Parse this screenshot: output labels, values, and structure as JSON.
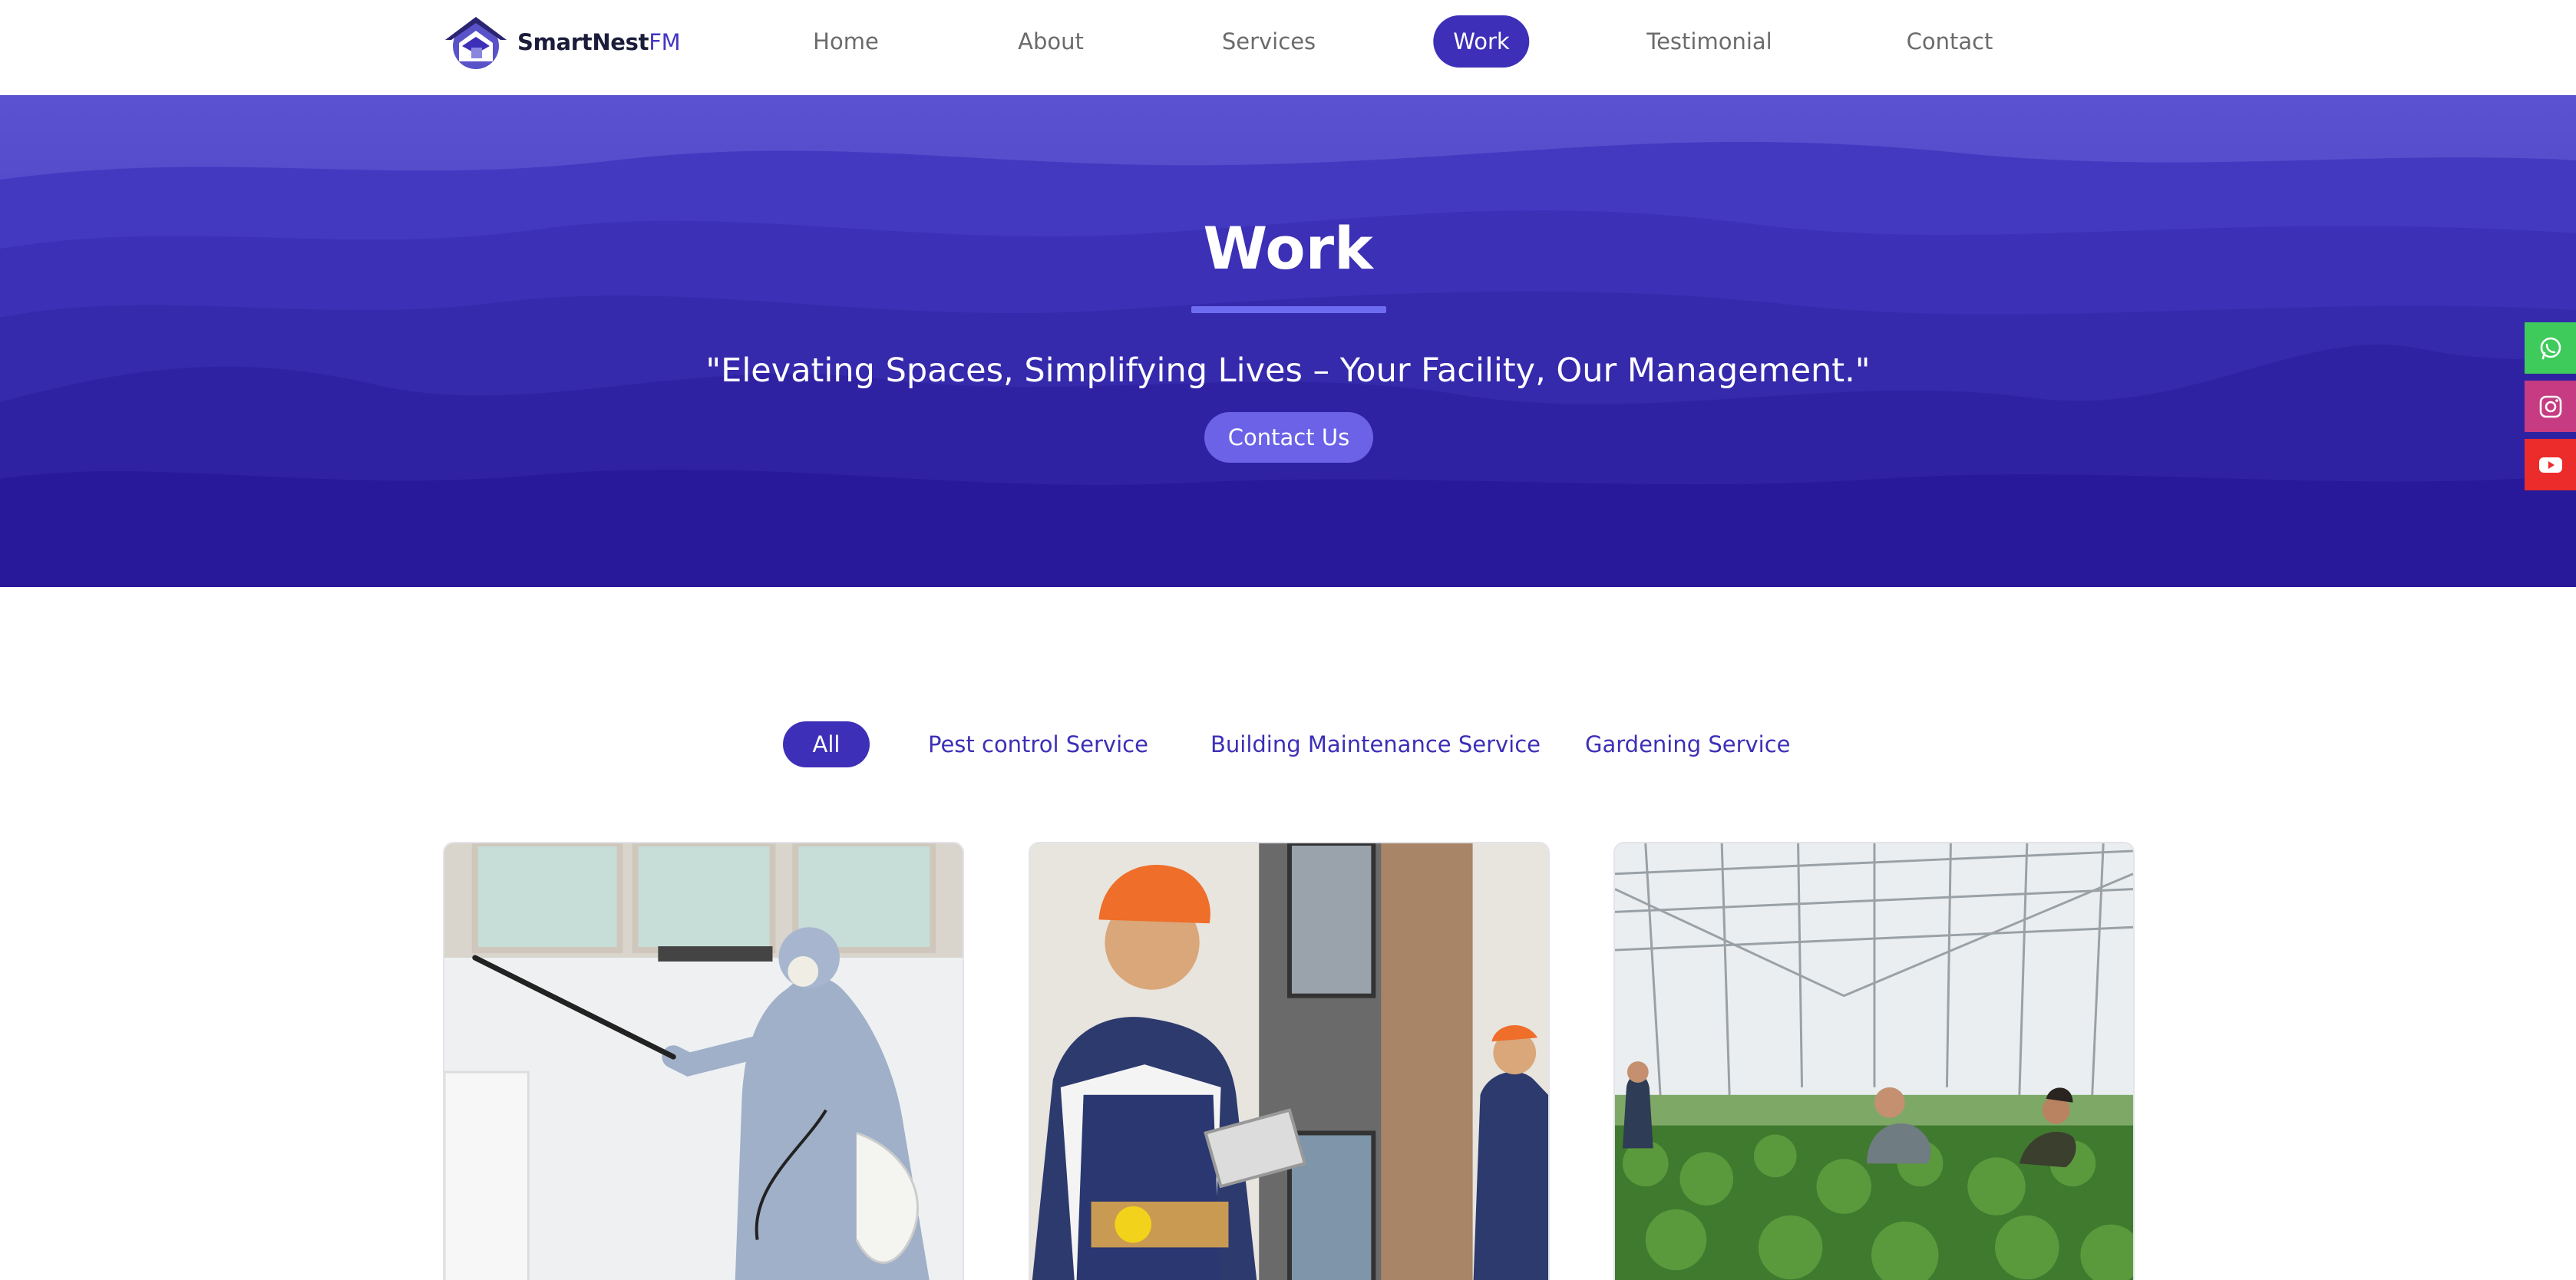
{
  "brand": {
    "name_main": "SmartNest",
    "name_suffix": "FM",
    "accent": "#3d2fb7"
  },
  "nav": {
    "items": [
      {
        "label": "Home"
      },
      {
        "label": "About"
      },
      {
        "label": "Services"
      },
      {
        "label": "Work",
        "active": true
      },
      {
        "label": "Testimonial"
      },
      {
        "label": "Contact"
      }
    ]
  },
  "hero": {
    "title": "Work",
    "tagline": "\"Elevating Spaces, Simplifying Lives – Your Facility, Our Management.\"",
    "cta_label": "Contact Us"
  },
  "social": [
    {
      "icon": "whatsapp-icon",
      "color": "#3ecb5c"
    },
    {
      "icon": "instagram-icon",
      "color": "#c63b82"
    },
    {
      "icon": "youtube-icon",
      "color": "#ec2b2b"
    }
  ],
  "filters": [
    {
      "label": "All",
      "active": true
    },
    {
      "label": "Pest control Service"
    },
    {
      "label": "Building Maintenance Service"
    },
    {
      "label": "Gardening Service"
    }
  ],
  "cards": [
    {
      "image": "pest-control-worker-spraying"
    },
    {
      "image": "construction-worker-with-tablet"
    },
    {
      "image": "greenhouse-gardening-workers"
    }
  ]
}
